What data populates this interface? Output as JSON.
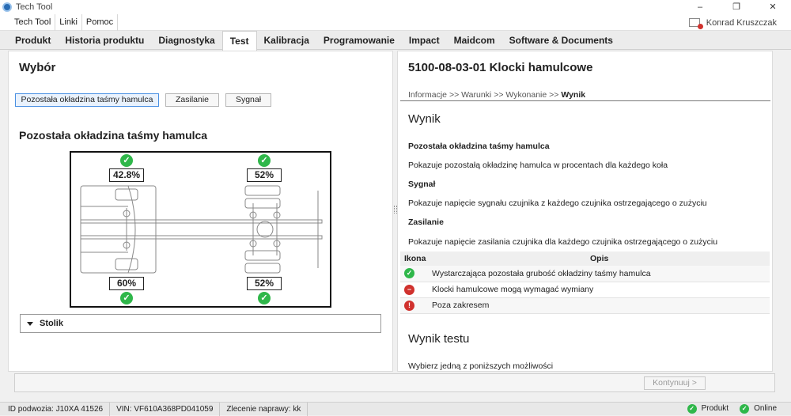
{
  "window": {
    "title": "Tech Tool",
    "controls": [
      "–",
      "❐",
      "✕"
    ]
  },
  "menu": [
    "Tech Tool",
    "Linki",
    "Pomoc"
  ],
  "user": {
    "name": "Konrad Kruszczak"
  },
  "tabs": [
    "Produkt",
    "Historia produktu",
    "Diagnostyka",
    "Test",
    "Kalibracja",
    "Programowanie",
    "Impact",
    "Maidcom",
    "Software & Documents"
  ],
  "active_tab": "Test",
  "left": {
    "title": "Wybór",
    "buttons": [
      "Pozostała okładzina taśmy hamulca",
      "Zasilanie",
      "Sygnał"
    ],
    "selected_button": "Pozostała okładzina taśmy hamulca",
    "section_title": "Pozostała okładzina taśmy hamulca",
    "wheels": {
      "front_left": "42.8%",
      "rear_left": "52%",
      "front_right": "60%",
      "rear_right": "52%"
    },
    "wheel_status_icon": "check-circle-icon",
    "collapsible": "Stolik"
  },
  "right": {
    "title": "5100-08-03-01 Klocki hamulcowe",
    "breadcrumb": {
      "b1": "Informacje",
      "b2": "Warunki",
      "b3": "Wykonanie",
      "current": "Wynik",
      "sep": ">>"
    },
    "wynik_heading": "Wynik",
    "sections": [
      {
        "title": "Pozostała okładzina taśmy hamulca",
        "desc": "Pokazuje pozostałą okładzinę hamulca w procentach dla każdego koła"
      },
      {
        "title": "Sygnał",
        "desc": "Pokazuje napięcie sygnału czujnika z każdego czujnika ostrzegającego o zużyciu"
      },
      {
        "title": "Zasilanie",
        "desc": "Pokazuje napięcie zasilania czujnika dla każdego czujnika ostrzegającego o zużyciu"
      }
    ],
    "table": {
      "headers": [
        "Ikona",
        "Opis"
      ],
      "rows": [
        {
          "icon": "ok",
          "text": "Wystarczająca pozostała grubość okładziny taśmy hamulca"
        },
        {
          "icon": "minus",
          "text": "Klocki hamulcowe mogą wymagać wymiany"
        },
        {
          "icon": "alert",
          "text": "Poza zakresem"
        }
      ]
    },
    "wynik_testu": "Wynik testu",
    "wynik_testu_desc": "Wybierz jedną z poniższych możliwości"
  },
  "bottom": {
    "continue_label": "Kontynuuj >"
  },
  "status": {
    "items": [
      "ID podwozia: J10XA 41526",
      "VIN: VF610A368PD041059",
      "Zlecenie naprawy: kk"
    ],
    "product": "Produkt",
    "online": "Online"
  },
  "colors": {
    "ok": "#2fb74a",
    "warn": "#d0312d",
    "select": "#4a90e2"
  }
}
